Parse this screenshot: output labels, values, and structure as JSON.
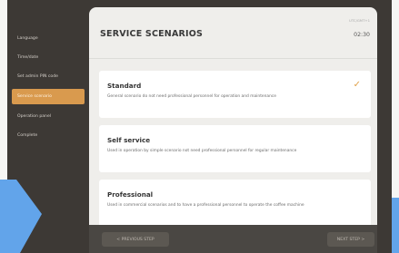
{
  "sidebar": {
    "items": [
      {
        "label": "Language"
      },
      {
        "label": "Time/date"
      },
      {
        "label": "Set admin PIN code"
      },
      {
        "label": "Service scenario"
      },
      {
        "label": "Operation panel"
      },
      {
        "label": "Complete"
      }
    ],
    "active_index": 3
  },
  "header": {
    "title": "SERVICE SCENARIOS",
    "time_label": "UTC/GMT+1",
    "time_value": "02:30"
  },
  "options": [
    {
      "title": "Standard",
      "description": "General scenario do not need professional personnel for operation and maintenance",
      "selected": true
    },
    {
      "title": "Self service",
      "description": "Used in operation by simple scenario not need professional personnel for regular maintenance",
      "selected": false
    },
    {
      "title": "Professional",
      "description": "Used in commercial scenarios and to have a professional personnel to operate the coffee machine",
      "selected": false
    }
  ],
  "footer": {
    "prev_label": "< PREVIOUS STEP",
    "next_label": "NEXT STEP >"
  },
  "colors": {
    "accent": "#d99a4e",
    "sidebar_bg": "#3d3935",
    "arrow": "#62a4ea"
  }
}
